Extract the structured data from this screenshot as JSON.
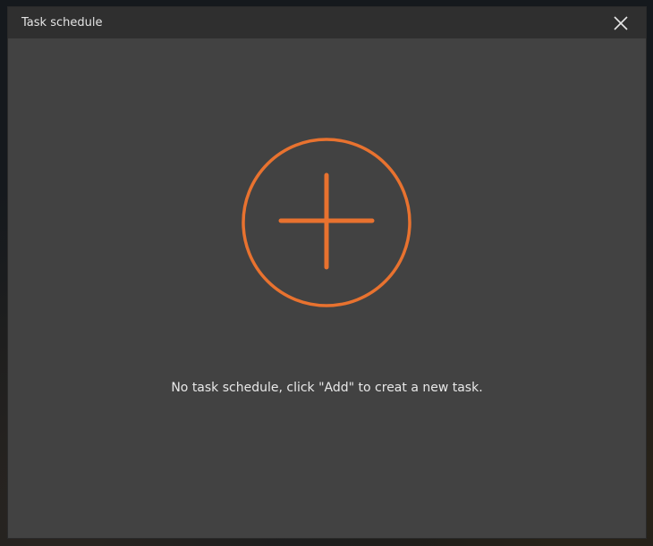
{
  "window": {
    "title": "Task schedule",
    "close_icon": "close-icon"
  },
  "empty_state": {
    "add_icon": "add-circle-plus-icon",
    "message": "No task schedule, click \"Add\" to creat a new task.",
    "accent_color": "#e8722f"
  },
  "colors": {
    "titlebar": "#2f2f2f",
    "body": "#424242",
    "text": "#e8e8e8"
  }
}
